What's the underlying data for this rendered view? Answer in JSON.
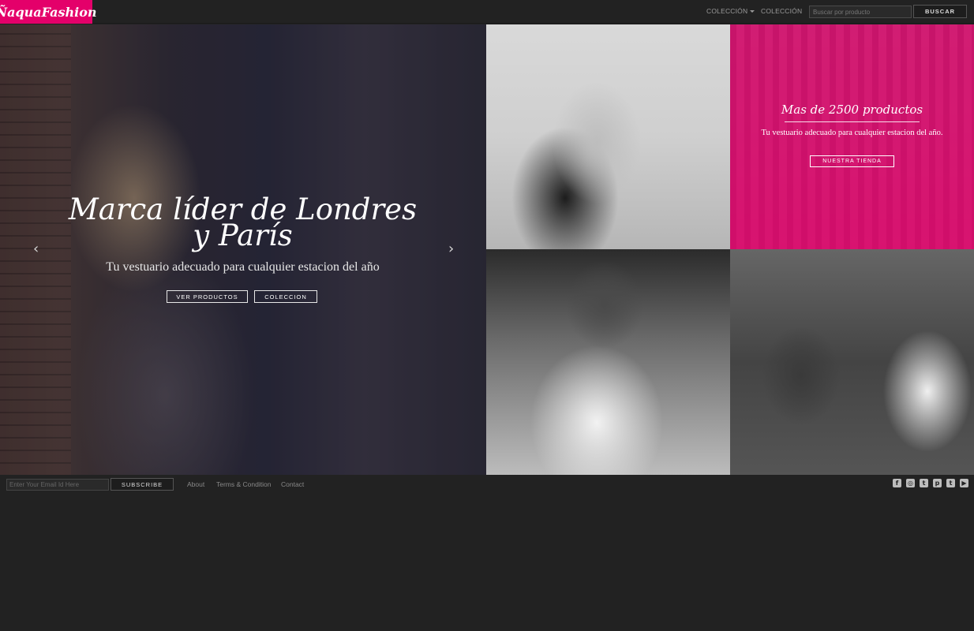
{
  "brand": {
    "logo_text": "ÑaquaFashion",
    "accent_color": "#e4006a"
  },
  "nav": {
    "items": [
      {
        "label": "COLECCIÓN",
        "has_dropdown": true
      },
      {
        "label": "COLECCIÓN",
        "has_dropdown": false
      }
    ],
    "search": {
      "placeholder": "Buscar por producto",
      "value": ""
    },
    "search_button": "BUSCAR"
  },
  "hero": {
    "title": "Marca líder de Londres y París",
    "subtitle": "Tu vestuario adecuado para cualquier estacion del año",
    "buttons": [
      "VER PRODUCTOS",
      "COLECCION"
    ],
    "prev_icon": "chevron-left-icon",
    "next_icon": "chevron-right-icon"
  },
  "promo": {
    "title": "Mas de 2500 productos",
    "subtitle": "Tu vestuario adecuado para cualquier estacion del año.",
    "button": "NUESTRA TIENDA"
  },
  "footer": {
    "email_placeholder": "Enter Your Email Id Here",
    "subscribe_label": "SUBSCRIBE",
    "links": [
      "About",
      "Terms & Condition",
      "Contact"
    ],
    "social": [
      "facebook-icon",
      "instagram-icon",
      "twitter-icon",
      "pinterest-icon",
      "tumblr-icon",
      "youtube-icon"
    ],
    "social_glyphs": [
      "f",
      "◎",
      "t",
      "p",
      "t",
      "▶"
    ]
  }
}
